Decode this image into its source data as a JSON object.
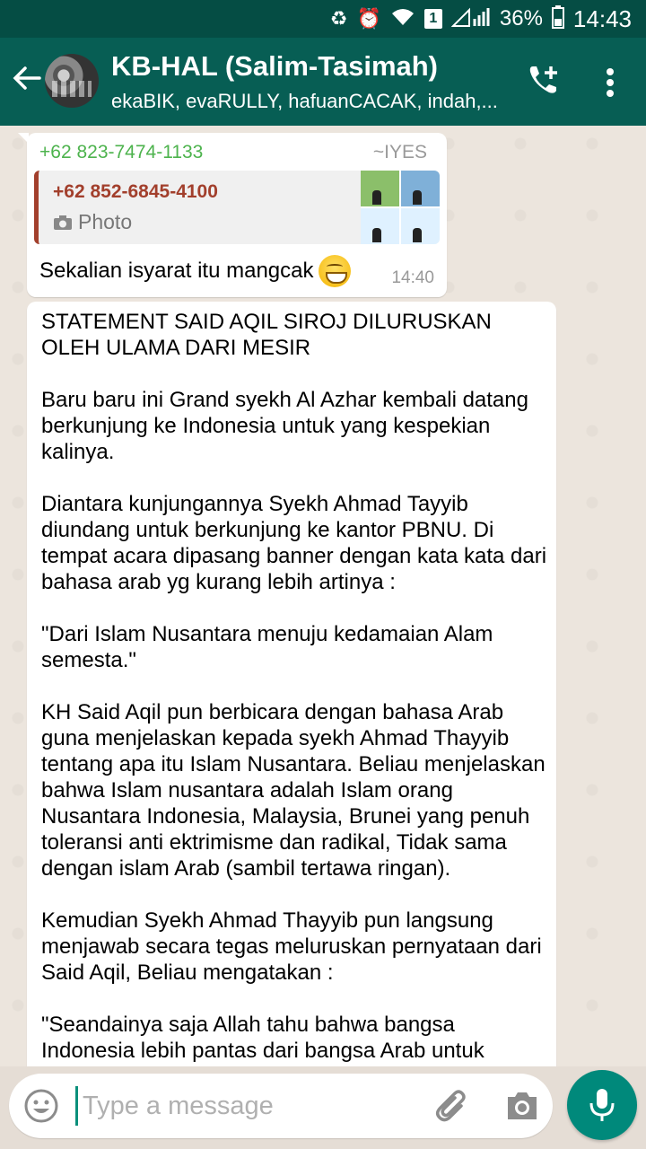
{
  "status_bar": {
    "battery_percent": "36%",
    "time": "14:43",
    "sim_badge": "1"
  },
  "header": {
    "title": "KB-HAL (Salim-Tasimah)",
    "members": "ekaBIK, evaRULLY, hafuanCACAK, indah,..."
  },
  "messages": [
    {
      "sender_phone": "+62 823-7474-1133",
      "sender_name": "~IYES",
      "quoted_phone": "+62 852-6845-4100",
      "quoted_type": "Photo",
      "text": "Sekalian isyarat itu mangcak",
      "time": "14:40"
    },
    {
      "text": "STATEMENT SAID AQIL SIROJ DILURUSKAN OLEH ULAMA DARI MESIR\n\nBaru baru ini Grand syekh Al Azhar kembali datang berkunjung ke Indonesia untuk yang kespekian kalinya.\n\nDiantara kunjungannya Syekh Ahmad Tayyib diundang untuk berkunjung ke kantor PBNU. Di tempat acara dipasang banner dengan kata kata dari bahasa arab yg kurang lebih artinya :\n\n\"Dari Islam Nusantara menuju kedamaian Alam semesta.\"\n\nKH Said Aqil pun berbicara dengan bahasa Arab guna menjelaskan kepada syekh Ahmad Thayyib tentang apa itu Islam Nusantara. Beliau menjelaskan bahwa Islam nusantara adalah Islam orang Nusantara Indonesia, Malaysia, Brunei yang penuh toleransi anti ektrimisme dan radikal, Tidak sama dengan islam Arab (sambil tertawa ringan).\n\nKemudian Syekh Ahmad Thayyib pun langsung menjawab secara tegas meluruskan pernyataan dari Said Aqil, Beliau mengatakan :\n\n\"Seandainya saja Allah tahu bahwa bangsa Indonesia lebih pantas dari bangsa Arab untuk"
    }
  ],
  "composer": {
    "placeholder": "Type a message"
  },
  "icons": [
    "back-arrow-icon",
    "add-call-icon",
    "more-vert-icon",
    "emoji-icon",
    "attach-icon",
    "camera-icon",
    "mic-icon"
  ],
  "colors": {
    "header": "#075e54",
    "status_bar": "#054d44",
    "accent": "#00897b",
    "sender_green": "#4db34d",
    "quote_red": "#a23f2c"
  }
}
